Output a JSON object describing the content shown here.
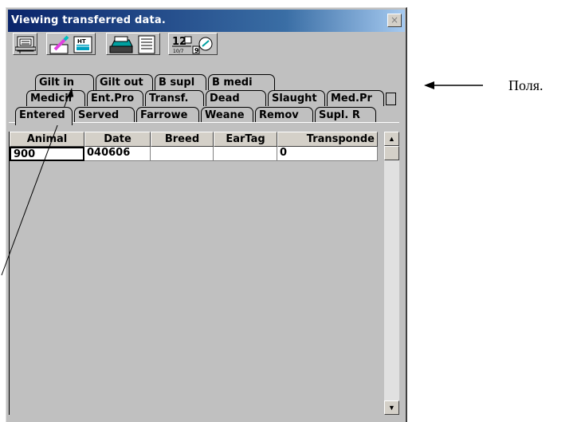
{
  "window": {
    "title": "Viewing transferred data.",
    "close_glyph": "×"
  },
  "toolbar": {
    "icons": [
      "form-icon",
      "edit-pen-icon",
      "data-sheet-icon",
      "printer-icon",
      "report-icon",
      "number-icon",
      "zoom-icon"
    ]
  },
  "tabs": {
    "row1": [
      "Gilt in",
      "Gilt out",
      "B supl",
      "B medi"
    ],
    "row2": [
      "Medicir",
      "Ent.Pro",
      "Transf.",
      "Dead",
      "Slaught",
      "Med.Pr"
    ],
    "row3": [
      "Entered",
      "Served",
      "Farrowe",
      "Weane",
      "Remov",
      "Supl. R"
    ]
  },
  "table": {
    "columns": [
      "Animal",
      "Date",
      "Breed",
      "EarTag",
      "Transponde"
    ],
    "rows": [
      [
        "900",
        "040606",
        "",
        "",
        "0"
      ]
    ]
  },
  "annotation": {
    "label": "Поля."
  }
}
